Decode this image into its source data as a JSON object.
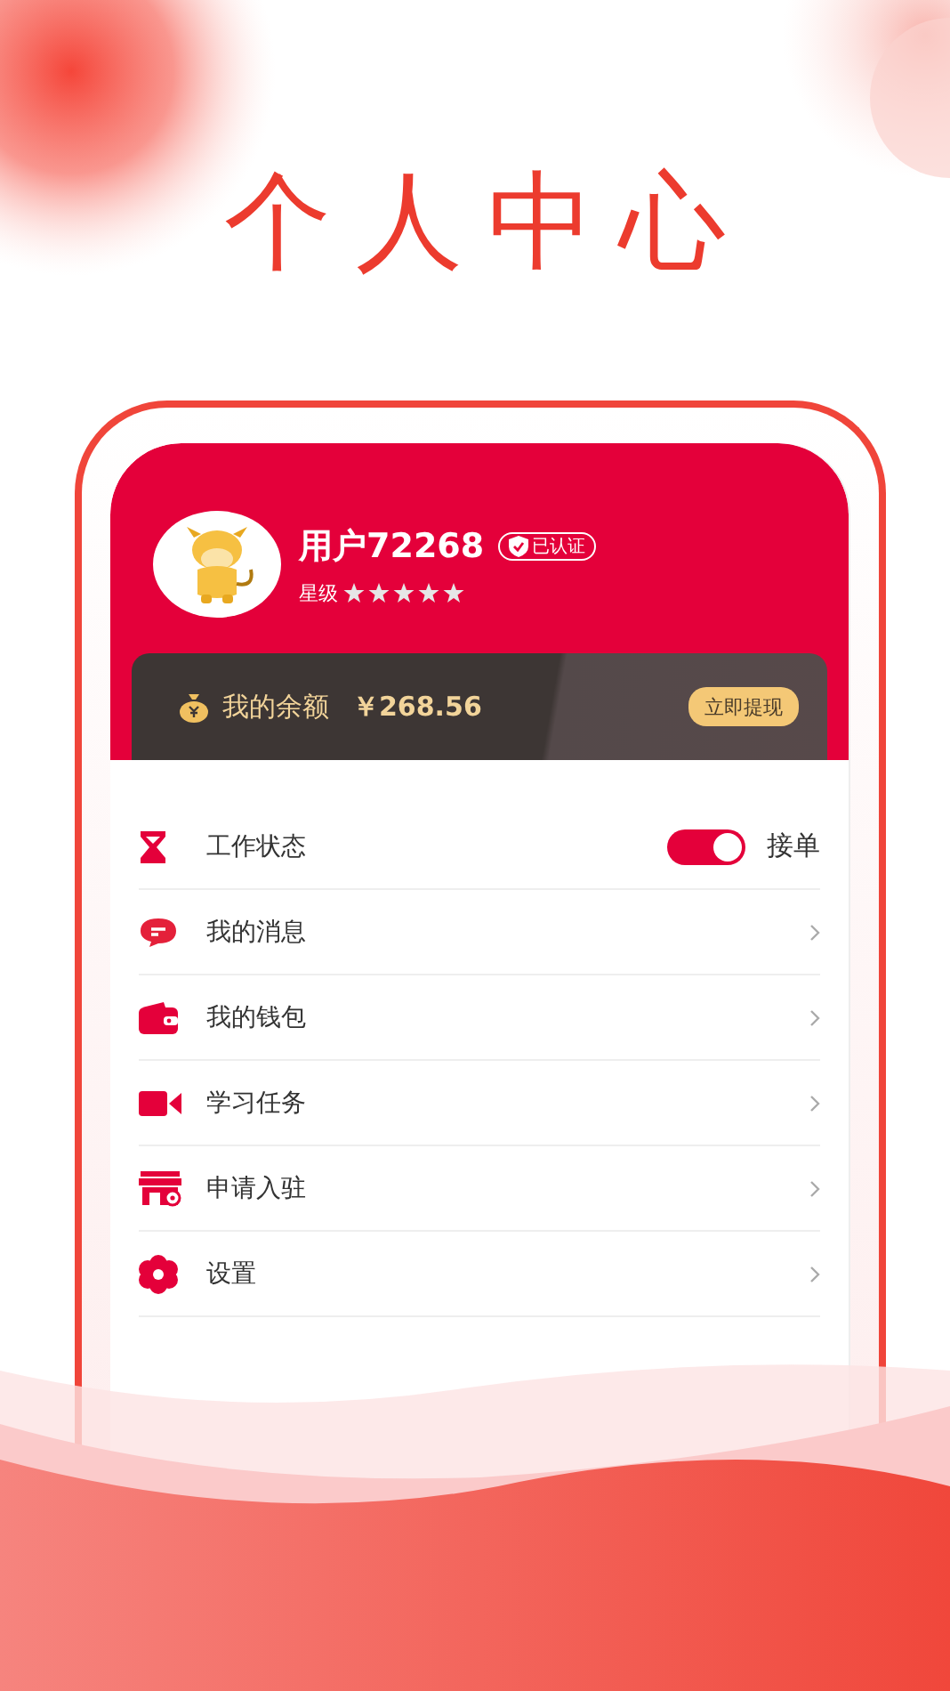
{
  "page_title": "个人中心",
  "profile": {
    "name": "用户72268",
    "badge": "已认证",
    "rating_label": "星级",
    "stars": 5
  },
  "balance": {
    "label": "我的余额",
    "amount": "￥268.56",
    "button": "立即提现"
  },
  "menu": [
    {
      "kind": "toggle",
      "label": "工作状态",
      "on": true,
      "state_text": "接单"
    },
    {
      "kind": "link",
      "label": "我的消息"
    },
    {
      "kind": "link",
      "label": "我的钱包"
    },
    {
      "kind": "link",
      "label": "学习任务"
    },
    {
      "kind": "link",
      "label": "申请入驻"
    },
    {
      "kind": "link",
      "label": "设置"
    }
  ]
}
